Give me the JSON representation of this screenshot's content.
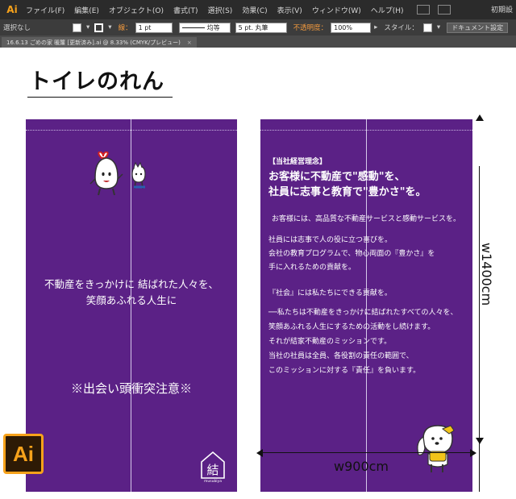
{
  "app": {
    "logo": "Ai",
    "menu": [
      "ファイル(F)",
      "編集(E)",
      "オブジェクト(O)",
      "書式(T)",
      "選択(S)",
      "効果(C)",
      "表示(V)",
      "ウィンドウ(W)",
      "ヘルプ(H)"
    ],
    "workspace": "初期設"
  },
  "controlbar": {
    "selection": "選択なし",
    "stroke_label": "線：",
    "stroke_weight": "1 pt",
    "stroke_style": "均等",
    "brush": "5 pt. 丸筆",
    "opacity_label": "不透明度：",
    "opacity_value": "100%",
    "style_label": "スタイル：",
    "doc_settings": "ドキュメント設定"
  },
  "document": {
    "tab_title": "16.6.13 ごめの家 暖簾 [更新済み].ai @ 8.33% (CMYK/プレビュー)",
    "close": "×"
  },
  "artboard": {
    "title": "トイレのれん",
    "left": {
      "line1": "不動産をきっかけに 結ばれた人々を、",
      "line2": "笑顔あふれる人生に",
      "notice": "※出会い頭衝突注意※",
      "logo_text": "結",
      "logo_sub": "musubiya"
    },
    "right": {
      "bracket": "【当社経営理念】",
      "head1": "お客様に不動産で\"感動\"を、",
      "head2": "社員に志事と教育で\"豊かさ\"を。",
      "p1": "お客様には、高品質な不動産サービスと感動サービスを。",
      "p2a": "社員には志事で人の役に立つ喜びを。",
      "p2b": "会社の教育プログラムで、物心両面の『豊かさ』を",
      "p2c": "手に入れるための貢献を。",
      "p3": "『社会』には私たちにできる貢献を。",
      "p4a": "──私たちは不動産をきっかけに結ばれたすべての人々を、",
      "p4b": "笑顔あふれる人生にするための活動をし続けます。",
      "p4c": "それが結家不動産のミッションです。",
      "p4d": "当社の社員は全員、各役割の責任の範囲で、",
      "p4e": "このミッションに対する『責任』を負います。"
    },
    "dim_height": "w1400cm",
    "dim_width": "w900cm"
  },
  "badge": "Ai",
  "colors": {
    "panel": "#5b2186",
    "accent": "#f7a21b"
  }
}
